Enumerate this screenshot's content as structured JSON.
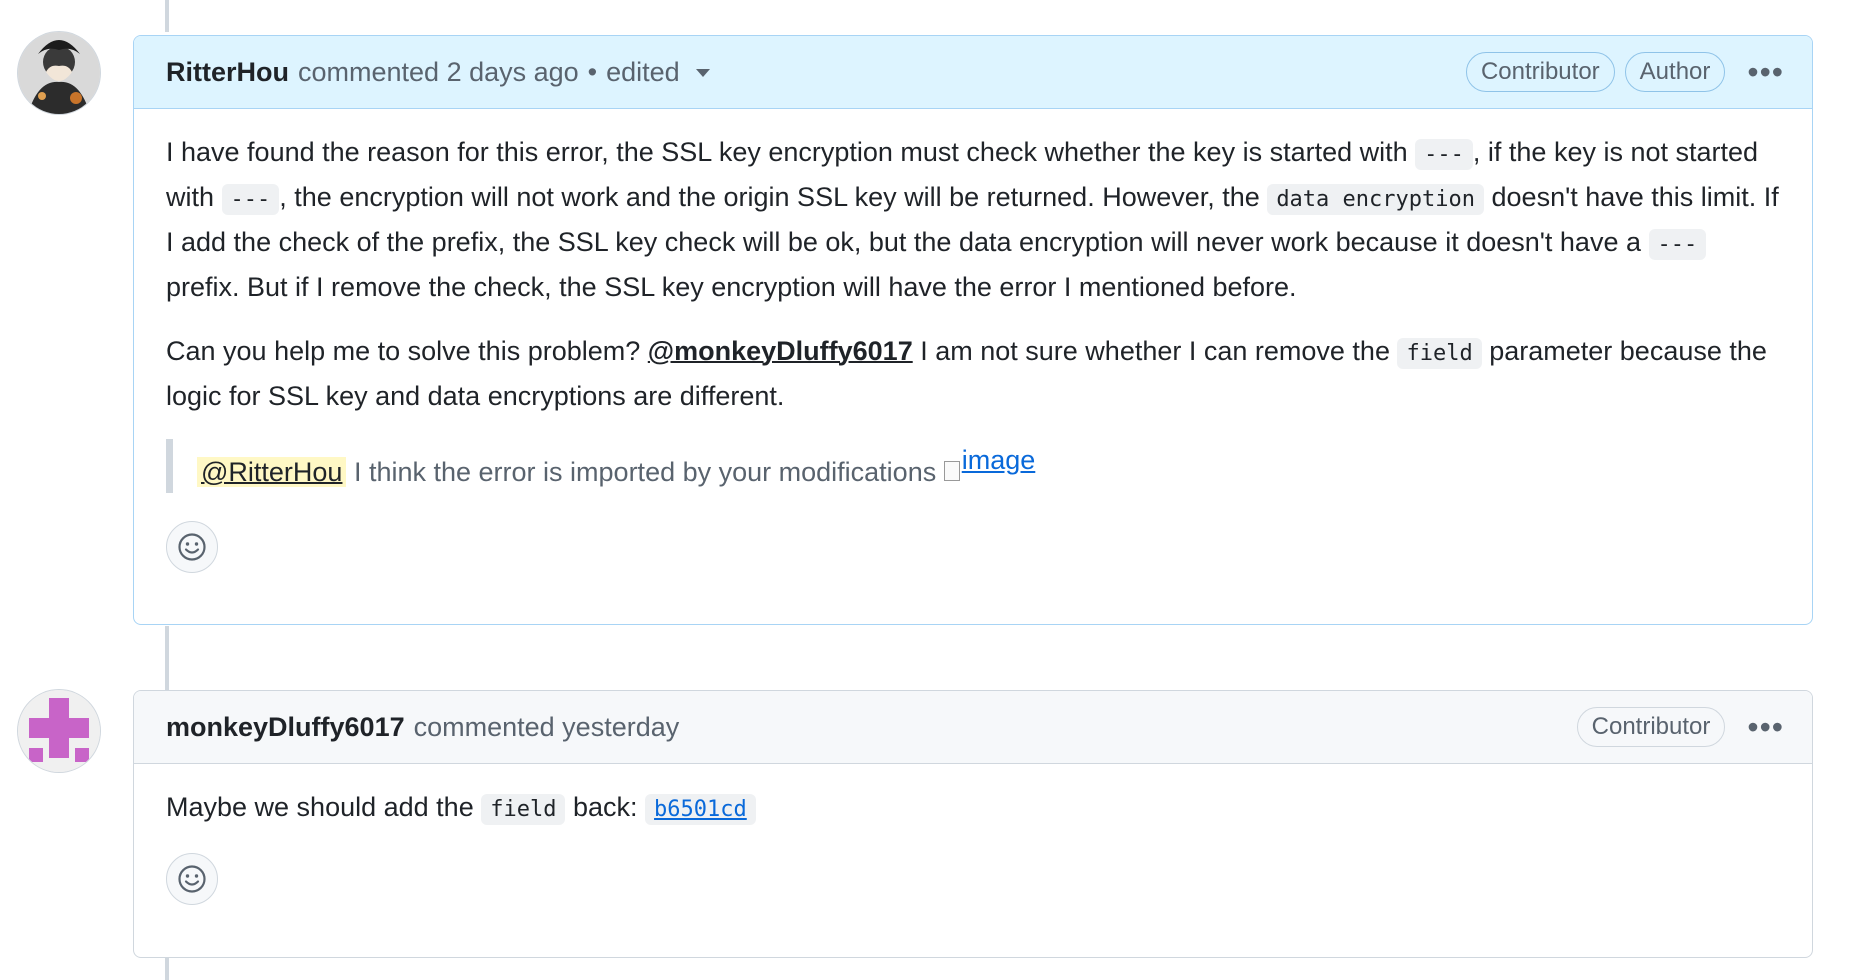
{
  "comments": [
    {
      "author": "RitterHou",
      "meta": "commented 2 days ago",
      "dot": "•",
      "edited": "edited",
      "badges": [
        "Contributor",
        "Author"
      ],
      "para1": {
        "t1": "I have found the reason for this error, the SSL key encryption must check whether the key is started with",
        "c1": "---",
        "t2": ", if the key is not started with",
        "c2": "---",
        "t3": ", the encryption will not work and the origin SSL key will be returned. However, the",
        "c3": "data encryption",
        "t4": "doesn't have this limit. If I add the check of the prefix, the SSL key check will be ok, but the data encryption will never work because it doesn't have a",
        "c4": "---",
        "t5": "prefix. But if I remove the check, the SSL key encryption will have the error I mentioned before."
      },
      "para2": {
        "t1": "Can you help me to solve this problem?",
        "mention": "@monkeyDluffy6017",
        "t2": "I am not sure whether I can remove the",
        "c1": "field",
        "t3": "parameter because the logic for SSL key and data encryptions are different."
      },
      "quote": {
        "mention": "@RitterHou",
        "text": "I think the error is imported by your modifications",
        "image_alt": "image"
      }
    },
    {
      "author": "monkeyDluffy6017",
      "meta": "commented yesterday",
      "badges": [
        "Contributor"
      ],
      "para1": {
        "t1": "Maybe we should add the",
        "c1": "field",
        "t2": "back:",
        "commit": "b6501cd"
      }
    }
  ],
  "icons": {
    "kebab": "kebab-horizontal-icon",
    "smiley": "smiley-icon",
    "caret": "triangle-down-icon"
  }
}
